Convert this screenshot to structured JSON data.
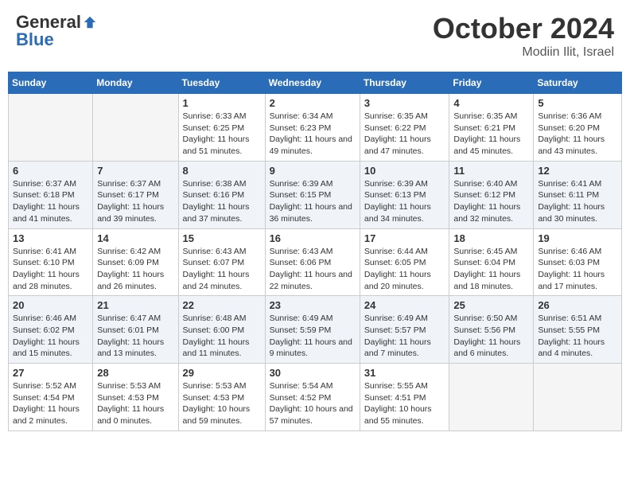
{
  "header": {
    "logo_general": "General",
    "logo_blue": "Blue",
    "month": "October 2024",
    "location": "Modiin Ilit, Israel"
  },
  "columns": [
    "Sunday",
    "Monday",
    "Tuesday",
    "Wednesday",
    "Thursday",
    "Friday",
    "Saturday"
  ],
  "weeks": [
    {
      "row_class": "row-odd",
      "days": [
        {
          "num": "",
          "empty": true
        },
        {
          "num": "",
          "empty": true
        },
        {
          "num": "1",
          "sunrise": "6:33 AM",
          "sunset": "6:25 PM",
          "daylight": "11 hours and 51 minutes."
        },
        {
          "num": "2",
          "sunrise": "6:34 AM",
          "sunset": "6:23 PM",
          "daylight": "11 hours and 49 minutes."
        },
        {
          "num": "3",
          "sunrise": "6:35 AM",
          "sunset": "6:22 PM",
          "daylight": "11 hours and 47 minutes."
        },
        {
          "num": "4",
          "sunrise": "6:35 AM",
          "sunset": "6:21 PM",
          "daylight": "11 hours and 45 minutes."
        },
        {
          "num": "5",
          "sunrise": "6:36 AM",
          "sunset": "6:20 PM",
          "daylight": "11 hours and 43 minutes."
        }
      ]
    },
    {
      "row_class": "row-even",
      "days": [
        {
          "num": "6",
          "sunrise": "6:37 AM",
          "sunset": "6:18 PM",
          "daylight": "11 hours and 41 minutes."
        },
        {
          "num": "7",
          "sunrise": "6:37 AM",
          "sunset": "6:17 PM",
          "daylight": "11 hours and 39 minutes."
        },
        {
          "num": "8",
          "sunrise": "6:38 AM",
          "sunset": "6:16 PM",
          "daylight": "11 hours and 37 minutes."
        },
        {
          "num": "9",
          "sunrise": "6:39 AM",
          "sunset": "6:15 PM",
          "daylight": "11 hours and 36 minutes."
        },
        {
          "num": "10",
          "sunrise": "6:39 AM",
          "sunset": "6:13 PM",
          "daylight": "11 hours and 34 minutes."
        },
        {
          "num": "11",
          "sunrise": "6:40 AM",
          "sunset": "6:12 PM",
          "daylight": "11 hours and 32 minutes."
        },
        {
          "num": "12",
          "sunrise": "6:41 AM",
          "sunset": "6:11 PM",
          "daylight": "11 hours and 30 minutes."
        }
      ]
    },
    {
      "row_class": "row-odd",
      "days": [
        {
          "num": "13",
          "sunrise": "6:41 AM",
          "sunset": "6:10 PM",
          "daylight": "11 hours and 28 minutes."
        },
        {
          "num": "14",
          "sunrise": "6:42 AM",
          "sunset": "6:09 PM",
          "daylight": "11 hours and 26 minutes."
        },
        {
          "num": "15",
          "sunrise": "6:43 AM",
          "sunset": "6:07 PM",
          "daylight": "11 hours and 24 minutes."
        },
        {
          "num": "16",
          "sunrise": "6:43 AM",
          "sunset": "6:06 PM",
          "daylight": "11 hours and 22 minutes."
        },
        {
          "num": "17",
          "sunrise": "6:44 AM",
          "sunset": "6:05 PM",
          "daylight": "11 hours and 20 minutes."
        },
        {
          "num": "18",
          "sunrise": "6:45 AM",
          "sunset": "6:04 PM",
          "daylight": "11 hours and 18 minutes."
        },
        {
          "num": "19",
          "sunrise": "6:46 AM",
          "sunset": "6:03 PM",
          "daylight": "11 hours and 17 minutes."
        }
      ]
    },
    {
      "row_class": "row-even",
      "days": [
        {
          "num": "20",
          "sunrise": "6:46 AM",
          "sunset": "6:02 PM",
          "daylight": "11 hours and 15 minutes."
        },
        {
          "num": "21",
          "sunrise": "6:47 AM",
          "sunset": "6:01 PM",
          "daylight": "11 hours and 13 minutes."
        },
        {
          "num": "22",
          "sunrise": "6:48 AM",
          "sunset": "6:00 PM",
          "daylight": "11 hours and 11 minutes."
        },
        {
          "num": "23",
          "sunrise": "6:49 AM",
          "sunset": "5:59 PM",
          "daylight": "11 hours and 9 minutes."
        },
        {
          "num": "24",
          "sunrise": "6:49 AM",
          "sunset": "5:57 PM",
          "daylight": "11 hours and 7 minutes."
        },
        {
          "num": "25",
          "sunrise": "6:50 AM",
          "sunset": "5:56 PM",
          "daylight": "11 hours and 6 minutes."
        },
        {
          "num": "26",
          "sunrise": "6:51 AM",
          "sunset": "5:55 PM",
          "daylight": "11 hours and 4 minutes."
        }
      ]
    },
    {
      "row_class": "row-odd",
      "days": [
        {
          "num": "27",
          "sunrise": "5:52 AM",
          "sunset": "4:54 PM",
          "daylight": "11 hours and 2 minutes."
        },
        {
          "num": "28",
          "sunrise": "5:53 AM",
          "sunset": "4:53 PM",
          "daylight": "11 hours and 0 minutes."
        },
        {
          "num": "29",
          "sunrise": "5:53 AM",
          "sunset": "4:53 PM",
          "daylight": "10 hours and 59 minutes."
        },
        {
          "num": "30",
          "sunrise": "5:54 AM",
          "sunset": "4:52 PM",
          "daylight": "10 hours and 57 minutes."
        },
        {
          "num": "31",
          "sunrise": "5:55 AM",
          "sunset": "4:51 PM",
          "daylight": "10 hours and 55 minutes."
        },
        {
          "num": "",
          "empty": true
        },
        {
          "num": "",
          "empty": true
        }
      ]
    }
  ]
}
